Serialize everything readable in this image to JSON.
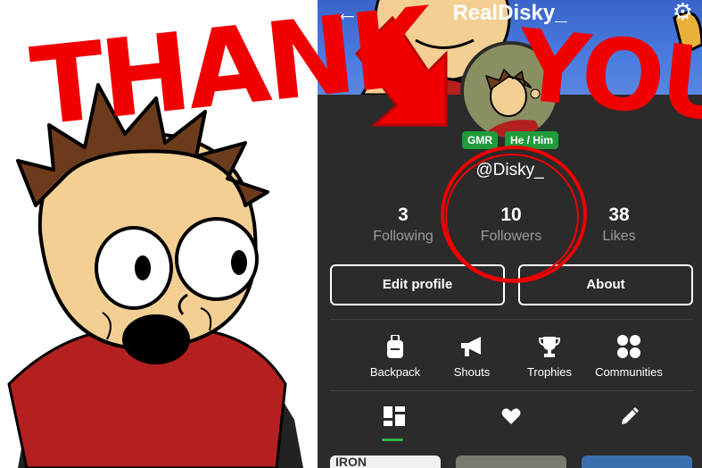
{
  "profile": {
    "display_name": "RealDisky_",
    "handle": "@Disky_",
    "badges": [
      "GMR",
      "He / Him"
    ],
    "back_icon": "arrow-left-icon",
    "settings_icon": "gear-icon"
  },
  "stats": [
    {
      "value": "3",
      "label": "Following"
    },
    {
      "value": "10",
      "label": "Followers"
    },
    {
      "value": "38",
      "label": "Likes"
    }
  ],
  "buttons": {
    "edit": "Edit profile",
    "about": "About"
  },
  "actions": [
    {
      "label": "Backpack",
      "icon": "backpack-icon"
    },
    {
      "label": "Shouts",
      "icon": "megaphone-icon"
    },
    {
      "label": "Trophies",
      "icon": "trophy-icon"
    },
    {
      "label": "Communities",
      "icon": "communities-icon"
    }
  ],
  "tabs": [
    {
      "icon": "posts-grid-icon",
      "selected": true
    },
    {
      "icon": "heart-icon",
      "selected": false
    },
    {
      "icon": "pencil-icon",
      "selected": false
    }
  ],
  "overlay_text": {
    "left": "THANK",
    "right": "YOU"
  },
  "thumb_text": "IRON",
  "colors": {
    "accent_green": "#1f9b3a",
    "scribble_red": "#f00000",
    "background": "#2b2b2b"
  }
}
